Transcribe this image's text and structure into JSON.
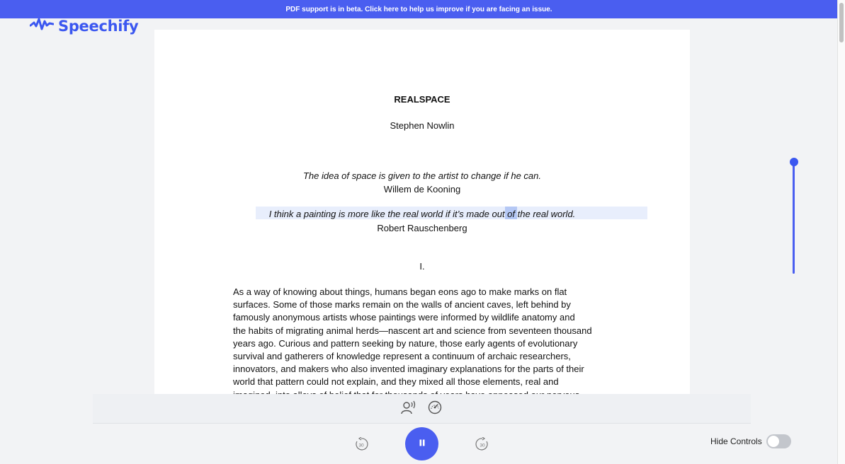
{
  "banner": {
    "text": "PDF support is in beta. Click here to help us improve if you are facing an issue."
  },
  "brand": {
    "name": "Speechify",
    "color": "#3b57f0"
  },
  "document": {
    "title": "REALSPACE",
    "author": "Stephen Nowlin",
    "quote1": "The idea of space is given to the artist to change if he can.",
    "quote1_attribution": "Willem de Kooning",
    "quote2": "I think a painting is more like the real world if it’s made out of the real world.",
    "quote2_attribution": "Robert Rauschenberg",
    "section": "I.",
    "paragraph": "As a way of knowing about things, humans began eons ago to make marks on flat\nsurfaces. Some of those marks remain on the walls of ancient caves, left behind by\nfamously anonymous artists whose paintings were informed by wildlife anatomy and\nthe habits of migrating animal herds—nascent art and science from seventeen thousand\nyears ago. Curious and pattern seeking by nature, those early agents of evolutionary\nsurvival and gatherers of knowledge represent a continuum of archaic researchers,\ninnovators, and makers who also invented imaginary explanations for the parts of their\nworld that pattern could not explain, and they mixed all those elements, real and\nimagined, into alloys of belief that for thousands of years have appeased our nervous"
  },
  "player": {
    "voice_icon": "voice-select-icon",
    "speed_icon": "speed-gauge-icon",
    "rewind_label": "30",
    "forward_label": "30",
    "state": "playing",
    "accent": "#4a5ef0"
  },
  "controls": {
    "hide_label": "Hide Controls",
    "hide_enabled": false
  },
  "reading_progress": 0.0
}
